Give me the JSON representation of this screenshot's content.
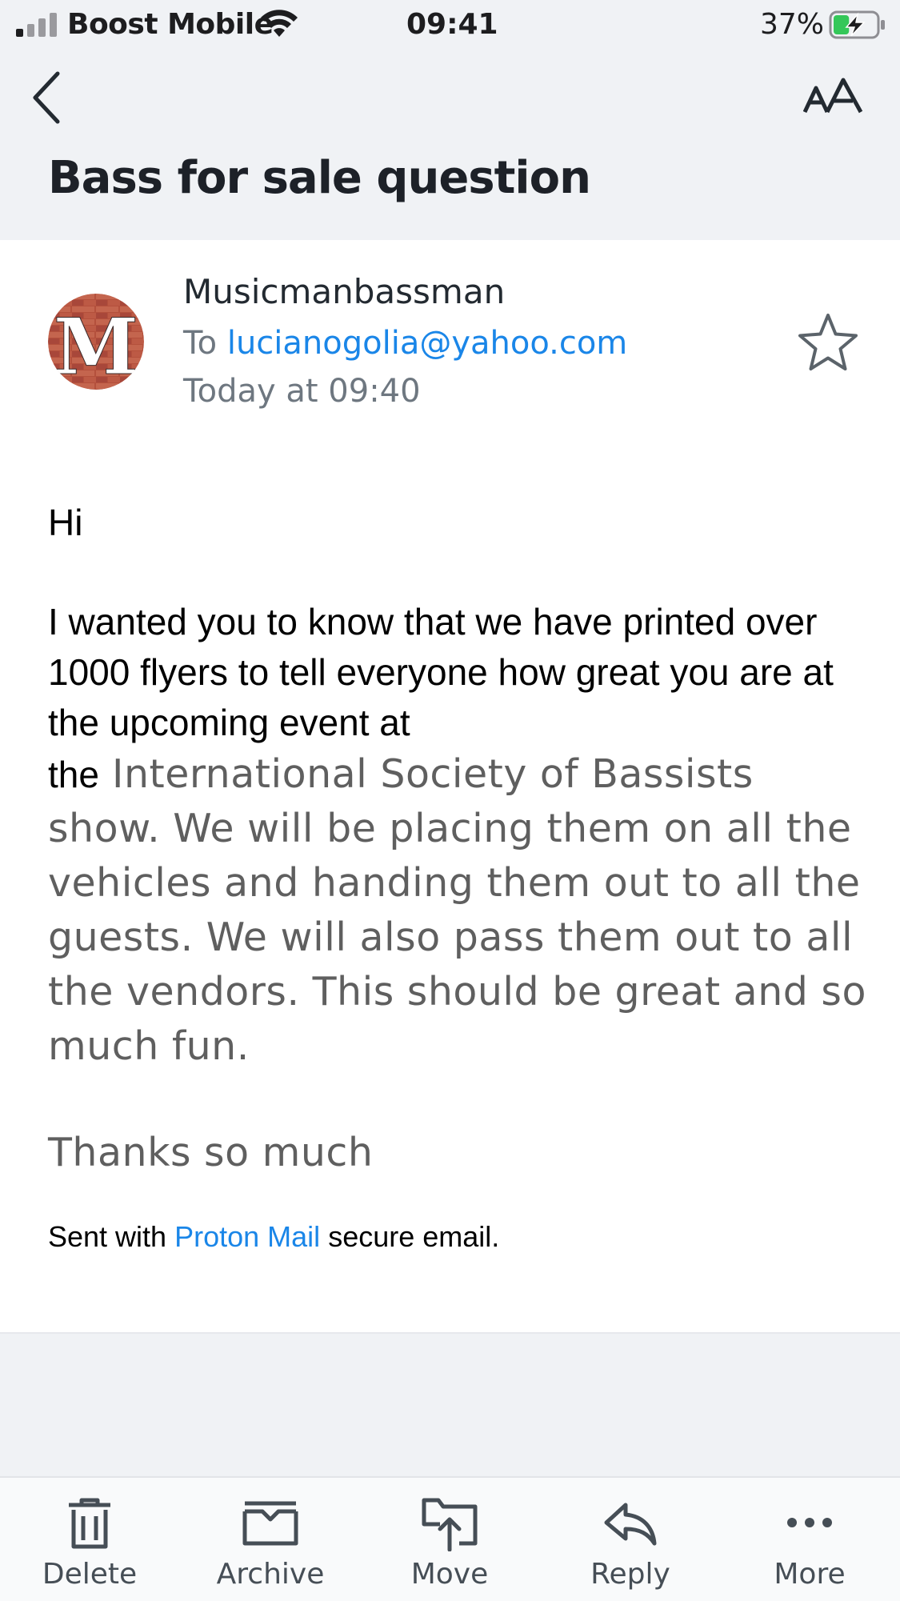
{
  "status_bar": {
    "carrier": "Boost Mobile",
    "time": "09:41",
    "battery_percent": "37%",
    "battery_level": 0.37,
    "charging": true
  },
  "header": {
    "back_icon": "chevron-left-icon",
    "text_size_icon": "text-size-icon",
    "subject": "Bass for sale question"
  },
  "message": {
    "sender_name": "Musicmanbassman",
    "avatar_letter": "M",
    "to_label": "To",
    "to_address": "lucianogolia@yahoo.com",
    "received": "Today at 09:40",
    "star_icon": "star-icon",
    "body": {
      "greeting": "Hi",
      "paragraph_part1": "I wanted you to know that we have printed over 1000 flyers to tell everyone how great you are at the upcoming event at",
      "paragraph_lead": "the",
      "paragraph_part2": "International Society of Bassists show. We will be placing them on all the vehicles and handing them out to all the guests. We will also pass them out to all the vendors. This should be great and so much fun.",
      "closing": "Thanks so much",
      "signature_prefix": "Sent with",
      "signature_link": "Proton Mail",
      "signature_suffix": "secure email."
    }
  },
  "toolbar": {
    "items": [
      {
        "label": "Delete",
        "icon": "trash-icon"
      },
      {
        "label": "Archive",
        "icon": "archive-icon"
      },
      {
        "label": "Move",
        "icon": "move-icon"
      },
      {
        "label": "Reply",
        "icon": "reply-icon"
      },
      {
        "label": "More",
        "icon": "more-icon"
      }
    ]
  },
  "colors": {
    "header_bg": "#f0f2f5",
    "link_blue": "#1a86e8",
    "muted_text": "#6e7780",
    "battery_green": "#34c759"
  }
}
